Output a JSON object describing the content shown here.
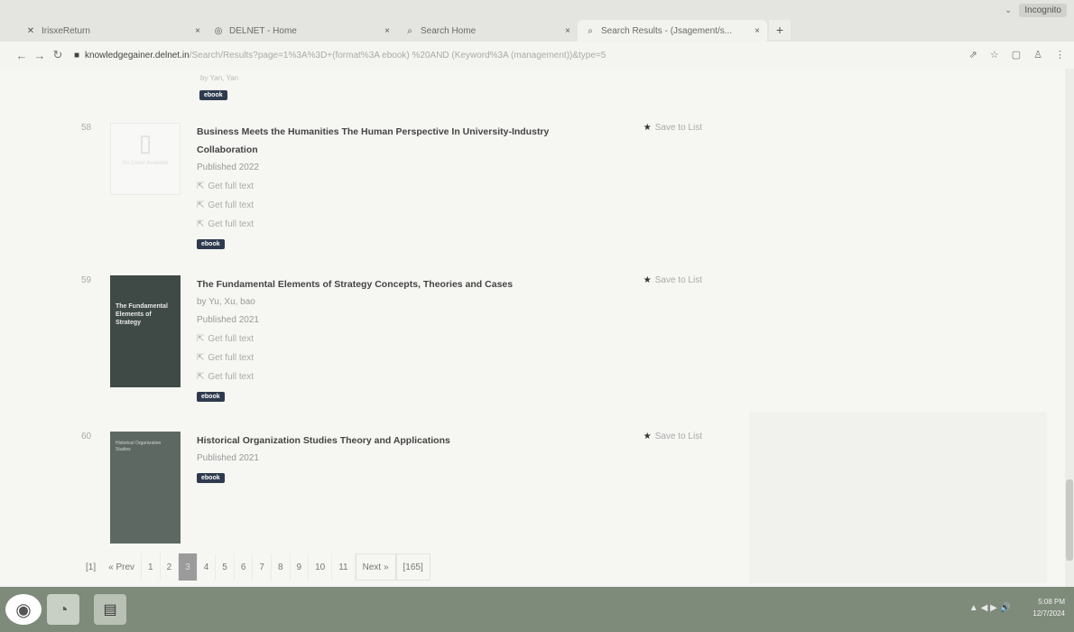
{
  "browser": {
    "tabs": [
      {
        "label": "IrisxeReturn",
        "icon": "app-icon",
        "close": "×",
        "active": false
      },
      {
        "label": "DELNET - Home",
        "icon": "globe-icon",
        "close": "×",
        "active": false
      },
      {
        "label": "Search Home",
        "icon": "search-icon",
        "close": "×",
        "active": false
      },
      {
        "label": "Search Results - (Jsagement/s...",
        "icon": "search-icon",
        "close": "×",
        "active": true
      }
    ],
    "new_tab": "+",
    "profile": "Incognito",
    "url_host": "knowledgegainer.delnet.in",
    "url_path": "/Search/Results?page=1%3A%3D+(format%3A ebook) %20AND (Keyword%3A (management))&type=5",
    "lock_icon": "lock-icon"
  },
  "results": [
    {
      "number": "58",
      "title": "Business Meets the Humanities The Human Perspective In University-Industry Collaboration",
      "author": "",
      "published": "Published 2022",
      "links": [
        "Get full text",
        "Get full text",
        "Get full text"
      ],
      "badge": "ebook",
      "save": "Save to List",
      "thumb": {
        "kind": "placeholder",
        "text": "No Cover Available"
      }
    },
    {
      "number": "59",
      "title": "The Fundamental Elements of Strategy Concepts, Theories and Cases",
      "author": "by Yu, Xu, bao",
      "published": "Published 2021",
      "links": [
        "Get full text",
        "Get full text",
        "Get full text"
      ],
      "badge": "ebook",
      "save": "Save to List",
      "thumb": {
        "kind": "cover",
        "text": "The Fundamental Elements of Strategy"
      }
    },
    {
      "number": "60",
      "title": "Historical Organization Studies Theory and Applications",
      "author": "",
      "published": "Published 2021",
      "links": [],
      "badge": "ebook",
      "save": "Save to List",
      "thumb": {
        "kind": "cover",
        "text": "Historical Organization Studies"
      }
    }
  ],
  "prev_result_tail": "by Yan, Yan",
  "prev_badge": "ebook",
  "pagination": {
    "first": "[1]",
    "prev": "« Prev",
    "pages": [
      "1",
      "2",
      "3",
      "4",
      "5",
      "6",
      "7",
      "8",
      "9",
      "10",
      "11"
    ],
    "current": "3",
    "next": "Next »",
    "last": "[165]"
  },
  "taskbar": {
    "apps": [
      "start-icon",
      "chrome-icon",
      "notepad-icon"
    ],
    "tray": "▲ ◀ ▶ 🔊",
    "time": "5:08 PM",
    "date": "12/7/2024"
  }
}
